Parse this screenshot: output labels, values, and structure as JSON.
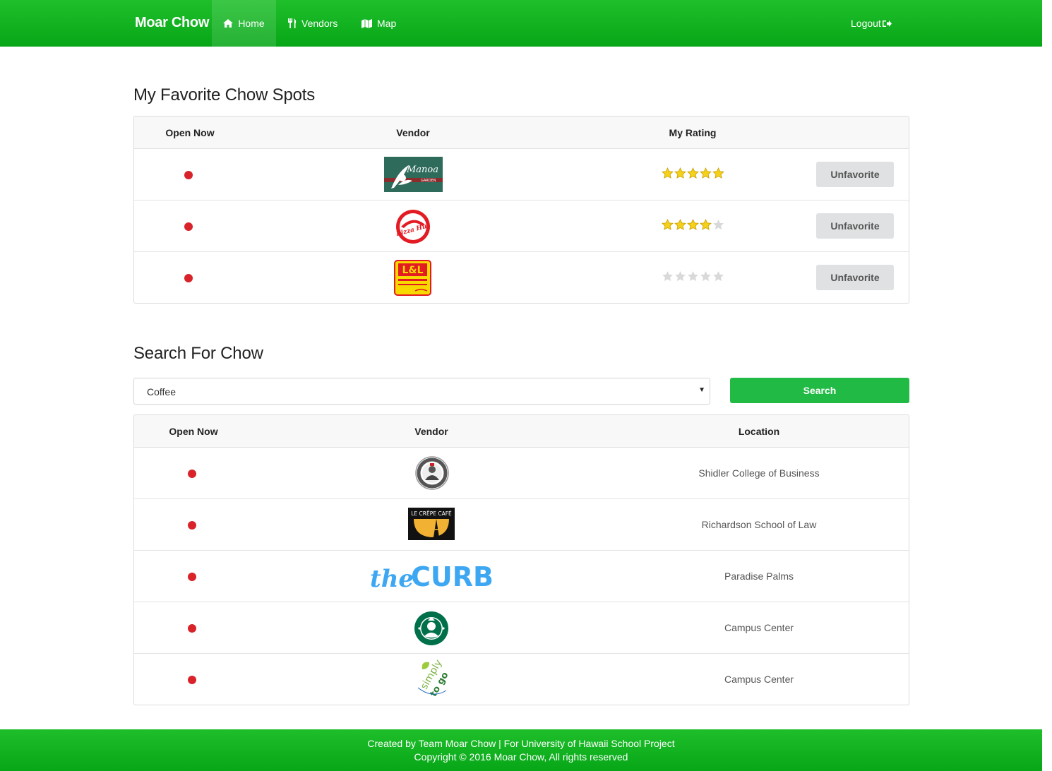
{
  "navbar": {
    "brand": "Moar Chow",
    "home_label": "Home",
    "vendors_label": "Vendors",
    "map_label": "Map",
    "logout_label": "Logout"
  },
  "favorites": {
    "title": "My Favorite Chow Spots",
    "headers": {
      "open_now": "Open Now",
      "vendor": "Vendor",
      "rating": "My Rating"
    },
    "rows": [
      {
        "vendor_logo": "manoa-garden-logo",
        "logo_text": "Manoa",
        "logo_subtext": "GARDEN",
        "rating": 5,
        "button": "Unfavorite"
      },
      {
        "vendor_logo": "pizza-hut-logo",
        "logo_text": "Pizza Hut",
        "rating": 4,
        "button": "Unfavorite"
      },
      {
        "vendor_logo": "l-and-l-logo",
        "logo_text": "L&L",
        "rating": 0,
        "button": "Unfavorite"
      }
    ]
  },
  "search": {
    "title": "Search For Chow",
    "selected": "Coffee",
    "button": "Search",
    "headers": {
      "open_now": "Open Now",
      "vendor": "Vendor",
      "location": "Location"
    },
    "rows": [
      {
        "vendor_logo": "bean-counter-logo",
        "location": "Shidler College of Business"
      },
      {
        "vendor_logo": "le-crepe-cafe-logo",
        "logo_text": "LE CRÊPE CAFÉ",
        "location": "Richardson School of Law"
      },
      {
        "vendor_logo": "the-curb-logo",
        "logo_text_a": "the",
        "logo_text_b": "CURB",
        "location": "Paradise Palms"
      },
      {
        "vendor_logo": "starbucks-logo",
        "location": "Campus Center"
      },
      {
        "vendor_logo": "simply-to-go-logo",
        "logo_text_a": "simply",
        "logo_text_b": "to go",
        "location": "Campus Center"
      }
    ]
  },
  "colors": {
    "nav_green": "#06a617",
    "search_green": "#21ba45",
    "closed_dot": "#d8232a",
    "star_gold": "#f5d11a"
  },
  "footer": {
    "line1": "Created by Team Moar Chow | For University of Hawaii School Project",
    "line2": "Copyright © 2016 Moar Chow, All rights reserved"
  }
}
